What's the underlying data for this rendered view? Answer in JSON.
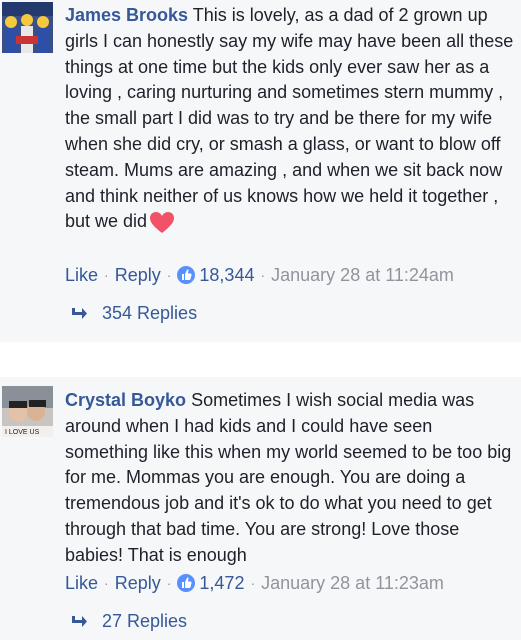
{
  "comments": [
    {
      "author": "James Brooks",
      "text": "This is lovely, as a dad of 2 grown up girls I can honestly say my wife may have been all these things at one time but the kids only ever saw her as a loving , caring nurturing and sometimes stern mummy , the small part I did was to try and be there for my wife when she did cry, or smash a glass, or want to blow off steam. Mums are amazing , and when we sit back now and think neither of us knows how we held it together , but we did",
      "emoji": "heart-icon",
      "like_label": "Like",
      "reply_label": "Reply",
      "reaction_count": "18,344",
      "timestamp": "January 28 at 11:24am",
      "replies_label": "354 Replies"
    },
    {
      "author": "Crystal Boyko",
      "text": "Sometimes I wish social media was around when I had kids and I could have seen something like this when my world seemed to be too big for me. Mommas you are enough. You are doing a tremendous job and it's ok to do what you need to get through that bad time. You are strong! Love those babies! That is enough",
      "avatar_caption": "I LOVE US",
      "like_label": "Like",
      "reply_label": "Reply",
      "reaction_count": "1,472",
      "timestamp": "January 28 at 11:23am",
      "replies_label": "27 Replies"
    }
  ],
  "separator": "·",
  "colors": {
    "link": "#365899",
    "text": "#1d2129",
    "meta": "#90949c",
    "card_bg": "#f6f7f9",
    "like_badge": "#5890ff",
    "heart": "#f25268"
  }
}
